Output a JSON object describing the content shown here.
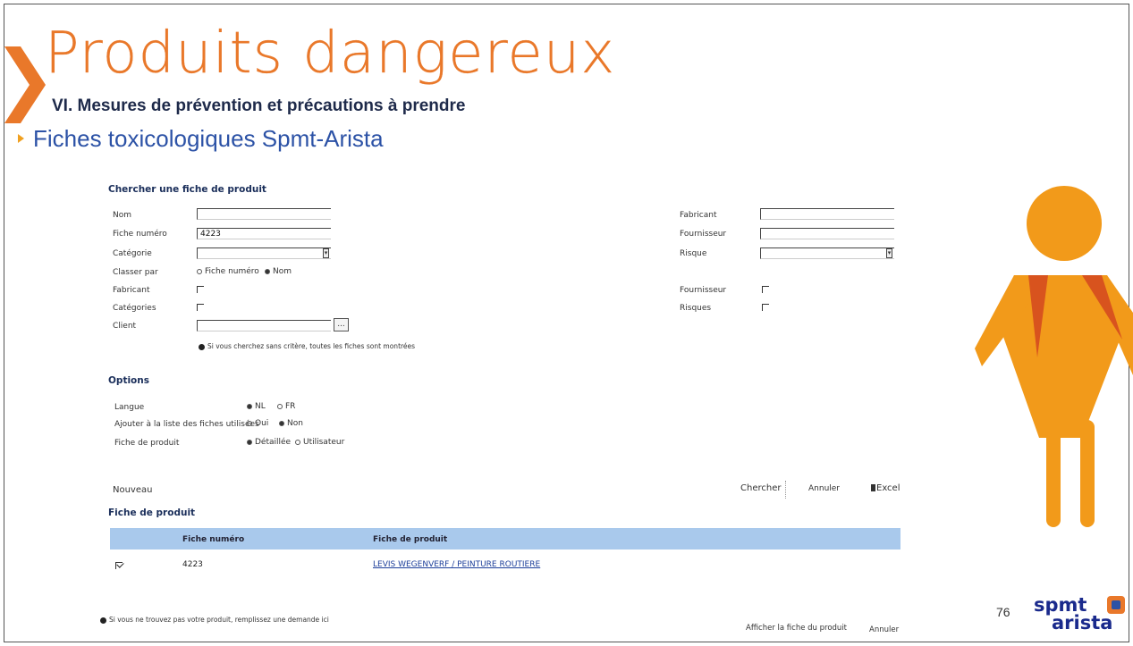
{
  "slide": {
    "title": "Produits dangereux",
    "subtitle": "VI. Mesures de prévention et précautions à prendre",
    "section": "Fiches toxicologiques Spmt-Arista",
    "page_number": "76",
    "logo_top": "spmt",
    "logo_bottom": "arista"
  },
  "search": {
    "heading": "Chercher une fiche de produit",
    "nom_label": "Nom",
    "fiche_num_label": "Fiche numéro",
    "fiche_num_value": "4223",
    "categorie_label": "Catégorie",
    "classer_par_label": "Classer par",
    "classer_opt_fiche": "Fiche numéro",
    "classer_opt_nom": "Nom",
    "fabricant_label": "Fabricant",
    "categories_label": "Catégories",
    "client_label": "Client",
    "client_btn": "...",
    "info_text": "Si vous cherchez sans critère, toutes les fiches sont montrées",
    "r_fabricant_label": "Fabricant",
    "r_fournisseur_label": "Fournisseur",
    "r_risque_label": "Risque",
    "r_fournisseur_chk_label": "Fournisseur",
    "r_risques_label": "Risques"
  },
  "options": {
    "heading": "Options",
    "langue_label": "Langue",
    "langue_nl": "NL",
    "langue_fr": "FR",
    "ajouter_label": "Ajouter à la liste des fiches utilisées",
    "ajouter_oui": "Oui",
    "ajouter_non": "Non",
    "fiche_label": "Fiche de produit",
    "fiche_detaillee": "Détaillée",
    "fiche_utilisateur": "Utilisateur"
  },
  "actions": {
    "nouveau": "Nouveau",
    "chercher": "Chercher",
    "annuler": "Annuler",
    "excel": "Excel"
  },
  "results": {
    "heading": "Fiche de produit",
    "col_num": "Fiche numéro",
    "col_prod": "Fiche de produit",
    "row_num": "4223",
    "row_prod": "LEVIS WEGENVERF / PEINTURE ROUTIERE"
  },
  "footer": {
    "info": "Si vous ne trouvez pas votre produit, remplissez une demande ici",
    "afficher": "Afficher la fiche du produit",
    "annuler": "Annuler"
  },
  "colors": {
    "orange": "#e9782a",
    "blue": "#2c52a6",
    "navy": "#1e2a4a",
    "table_header": "#a9c9ec"
  }
}
